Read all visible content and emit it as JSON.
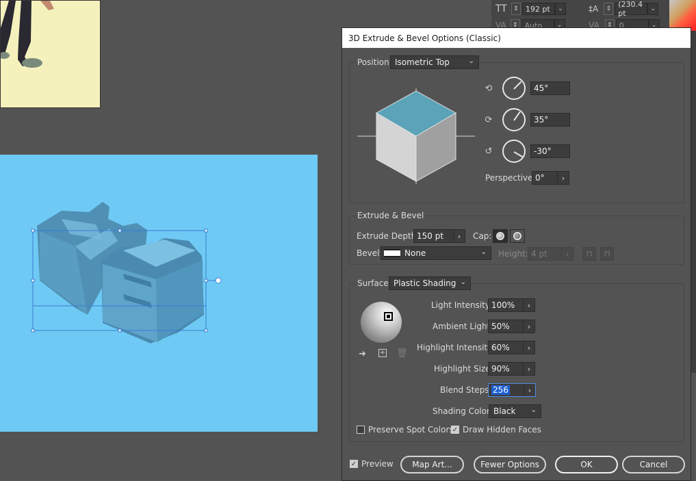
{
  "char_panel": {
    "font_size": "192 pt",
    "leading": "(230.4 pt",
    "kerning": "Auto",
    "tracking": "0"
  },
  "dialog": {
    "title": "3D Extrude & Bevel Options (Classic)",
    "position_label": "Position:",
    "position_value": "Isometric Top",
    "rot_x": "45°",
    "rot_y": "35°",
    "rot_z": "-30°",
    "perspective_label": "Perspective:",
    "perspective_value": "0°",
    "extrude_section": "Extrude & Bevel",
    "extrude_depth_label": "Extrude Depth:",
    "extrude_depth_value": "150 pt",
    "cap_label": "Cap:",
    "bevel_label": "Bevel:",
    "bevel_value": "None",
    "height_label": "Height:",
    "height_value": "4 pt",
    "surface_label": "Surface:",
    "surface_value": "Plastic Shading",
    "light_intensity_label": "Light Intensity:",
    "light_intensity_value": "100%",
    "ambient_light_label": "Ambient Light:",
    "ambient_light_value": "50%",
    "highlight_intensity_label": "Highlight Intensity:",
    "highlight_intensity_value": "60%",
    "highlight_size_label": "Highlight Size:",
    "highlight_size_value": "90%",
    "blend_steps_label": "Blend Steps:",
    "blend_steps_value": "256",
    "shading_color_label": "Shading Color:",
    "shading_color_value": "Black",
    "preserve_spot_label": "Preserve Spot Colors",
    "draw_hidden_label": "Draw Hidden Faces",
    "preview_label": "Preview",
    "map_art_label": "Map Art...",
    "fewer_options_label": "Fewer Options",
    "ok_label": "OK",
    "cancel_label": "Cancel"
  },
  "colors": {
    "canvas_bg": "#535353",
    "artboard_blue": "#6ecaf4",
    "artboard_yellow": "#f4f1bd",
    "cube_top": "#5ba3b8",
    "selection_blue": "#3a7bd5"
  }
}
